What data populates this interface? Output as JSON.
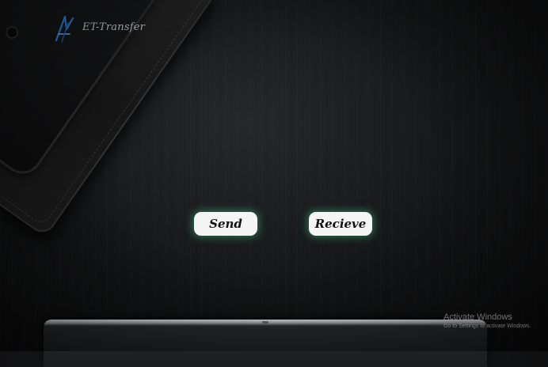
{
  "brand": {
    "name": "ET-Transfer",
    "icon": "et-transfer-logo"
  },
  "actions": {
    "send_label": "Send",
    "receive_label": "Recieve"
  },
  "theme": {
    "button_glow": "#3cb478",
    "button_bg": "#f4f5f4",
    "background": "#141516"
  },
  "watermark": {
    "title": "Activate Windows",
    "subtitle": "Go to Settings to activate Windows."
  }
}
